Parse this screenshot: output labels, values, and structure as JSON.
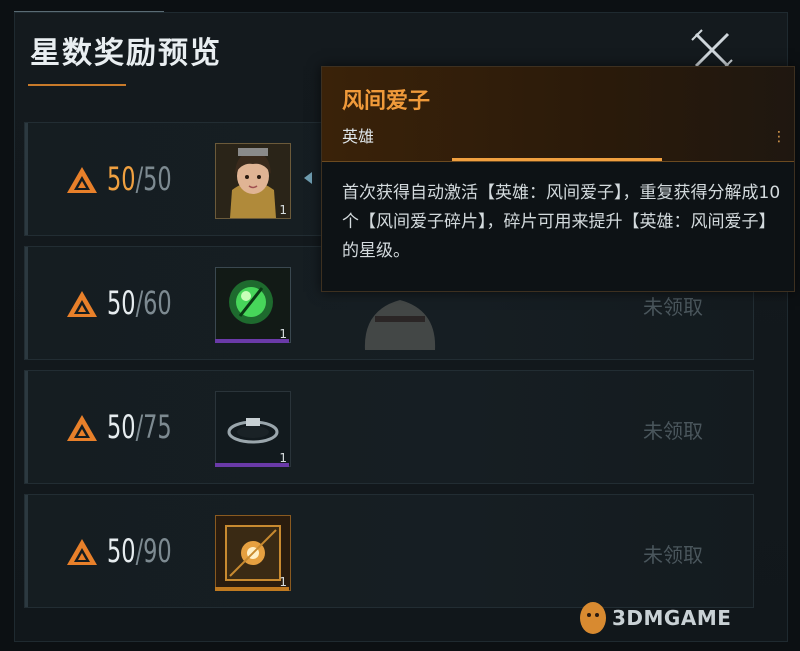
{
  "header": {
    "title": "星数奖励预览"
  },
  "colors": {
    "accent": "#f0a040",
    "panel": "#141a1e",
    "tooltip_head": "#3a2209"
  },
  "rewards": [
    {
      "current": "50",
      "separator": "/",
      "required": "50",
      "item_icon": "hero-portrait-icon",
      "quantity": "1",
      "status": ""
    },
    {
      "current": "50",
      "separator": "/",
      "required": "60",
      "item_icon": "green-orb-icon",
      "quantity": "1",
      "status": "未领取"
    },
    {
      "current": "50",
      "separator": "/",
      "required": "75",
      "item_icon": "dark-ring-icon",
      "quantity": "1",
      "status": "未领取"
    },
    {
      "current": "50",
      "separator": "/",
      "required": "90",
      "item_icon": "golden-crate-icon",
      "quantity": "1",
      "status": "未领取"
    }
  ],
  "tooltip": {
    "title": "风间爱子",
    "type": "英雄",
    "description": "首次获得自动激活【英雄：风间爱子】，重复获得分解成10个【风间爱子碎片】，碎片可用来提升【英雄：风间爱子】的星级。"
  },
  "watermark": {
    "text": "3DMGAME"
  }
}
